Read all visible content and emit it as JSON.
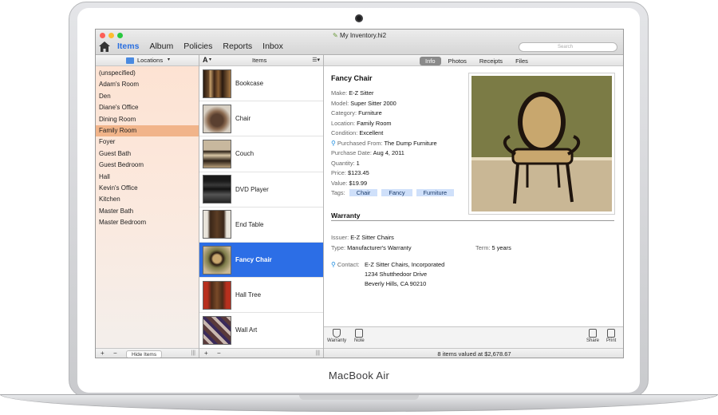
{
  "device": {
    "brand": "MacBook Air"
  },
  "window": {
    "title": "My Inventory.hi2",
    "search_placeholder": "Search"
  },
  "toolbar": {
    "tabs": [
      "Items",
      "Album",
      "Policies",
      "Reports",
      "Inbox"
    ],
    "active": "Items"
  },
  "locations": {
    "header": "Locations",
    "items": [
      "(unspecified)",
      "Adam's Room",
      "Den",
      "Diane's Office",
      "Dining Room",
      "Family Room",
      "Foyer",
      "Guest Bath",
      "Guest Bedroom",
      "Hall",
      "Kevin's Office",
      "Kitchen",
      "Master Bath",
      "Master Bedroom"
    ],
    "selected": "Family Room",
    "hide_button": "Hide Items"
  },
  "items": {
    "header": "Items",
    "sort_label": "A",
    "list": [
      "Bookcase",
      "Chair",
      "Couch",
      "DVD Player",
      "End Table",
      "Fancy Chair",
      "Hall Tree",
      "Wall Art"
    ],
    "selected": "Fancy Chair"
  },
  "detail": {
    "tabs": [
      "Info",
      "Photos",
      "Receipts",
      "Files"
    ],
    "active_tab": "Info",
    "name": "Fancy Chair",
    "fields": [
      {
        "label": "Make:",
        "value": "E-Z Sitter"
      },
      {
        "label": "Model:",
        "value": "Super Sitter 2000"
      },
      {
        "label": "Category:",
        "value": "Furniture"
      },
      {
        "label": "Location:",
        "value": "Family Room"
      },
      {
        "label": "Condition:",
        "value": "Excellent"
      },
      {
        "label": "Purchased From:",
        "value": "The Dump Furniture"
      },
      {
        "label": "Purchase Date:",
        "value": "Aug 4, 2011"
      },
      {
        "label": "Quantity:",
        "value": "1"
      },
      {
        "label": "Price:",
        "value": "$123.45"
      },
      {
        "label": "Value:",
        "value": "$19.99"
      }
    ],
    "tags_label": "Tags:",
    "tags": [
      "Chair",
      "Fancy",
      "Furniture"
    ],
    "warranty": {
      "title": "Warranty",
      "issuer_label": "Issuer:",
      "issuer": "E-Z Sitter Chairs",
      "type_label": "Type:",
      "type": "Manufacturer's Warranty",
      "term_label": "Term:",
      "term": "5 years",
      "contact_label": "Contact:",
      "contact": [
        "E-Z Sitter Chairs, Incorporated",
        "1234 Shutthedoor Drive",
        "Beverly Hills, CA 90210"
      ]
    },
    "footer_buttons": {
      "warranty": "Warranty",
      "note": "Note",
      "share": "Share",
      "print": "Print"
    },
    "status": "8 items valued at $2,678.67"
  },
  "colors": {
    "accent": "#2c6ee6",
    "location_selected": "#f1b48a",
    "tag_bg": "#cfe0fa"
  }
}
